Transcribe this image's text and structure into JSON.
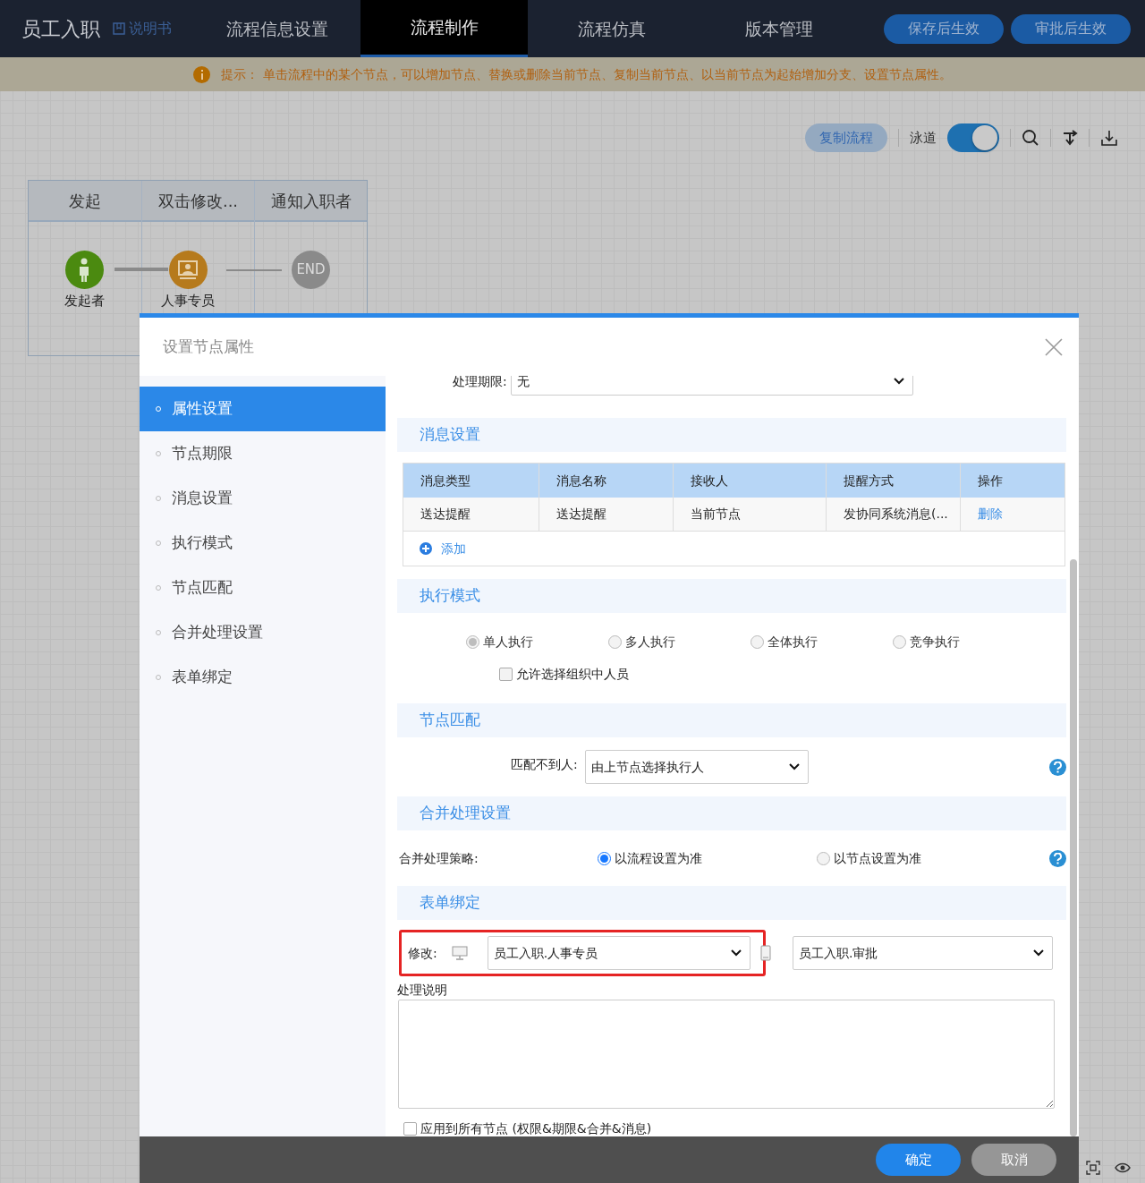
{
  "app": {
    "title": "员工入职",
    "manual_link": "说明书",
    "nav_tabs": [
      {
        "label": "流程信息设置",
        "selected": false
      },
      {
        "label": "流程制作",
        "selected": true
      },
      {
        "label": "流程仿真",
        "selected": false
      },
      {
        "label": "版本管理",
        "selected": false
      }
    ],
    "actions": [
      "保存后生效",
      "审批后生效"
    ]
  },
  "hint": {
    "text": "提示： 单击流程中的某个节点，可以增加节点、替换或删除当前节点、复制当前节点、以当前节点为起始增加分支、设置节点属性。"
  },
  "toolbar": {
    "copy_button": "复制流程",
    "lane_toggle": {
      "label": "泳道",
      "on": true
    }
  },
  "lanes": [
    {
      "title": "发起"
    },
    {
      "title": "双击修改..."
    },
    {
      "title": "通知入职者"
    }
  ],
  "nodes": [
    {
      "kind": "start",
      "label": "发起者"
    },
    {
      "kind": "task",
      "label": "人事专员"
    },
    {
      "kind": "end",
      "label": "END"
    }
  ],
  "dialog": {
    "title": "设置节点属性",
    "side_items": [
      {
        "label": "属性设置",
        "selected": true
      },
      {
        "label": "节点期限",
        "selected": false
      },
      {
        "label": "消息设置",
        "selected": false
      },
      {
        "label": "执行模式",
        "selected": false
      },
      {
        "label": "节点匹配",
        "selected": false
      },
      {
        "label": "合并处理设置",
        "selected": false
      },
      {
        "label": "表单绑定",
        "selected": false
      }
    ],
    "deadline": {
      "label": "处理期限:",
      "value": "无"
    },
    "message": {
      "title": "消息设置",
      "columns": [
        "消息类型",
        "消息名称",
        "接收人",
        "提醒方式",
        "操作"
      ],
      "rows": [
        [
          "送达提醒",
          "送达提醒",
          "当前节点",
          "发协同系统消息(...",
          "删除"
        ]
      ],
      "add_link": "添加"
    },
    "exec_mode": {
      "title": "执行模式",
      "disabled": true,
      "options": [
        {
          "label": "单人执行",
          "selected": true
        },
        {
          "label": "多人执行",
          "selected": false
        },
        {
          "label": "全体执行",
          "selected": false
        },
        {
          "label": "竞争执行",
          "selected": false
        }
      ],
      "org_checkbox": {
        "label": "允许选择组织中人员",
        "checked": false
      }
    },
    "match": {
      "title": "节点匹配",
      "label": "匹配不到人:",
      "value": "由上节点选择执行人"
    },
    "merge": {
      "title": "合并处理设置",
      "label": "合并处理策略:",
      "options": [
        {
          "label": "以流程设置为准",
          "selected": true
        },
        {
          "label": "以节点设置为准",
          "selected": false
        }
      ]
    },
    "form_binding": {
      "title": "表单绑定",
      "label": "修改:",
      "pc_form": "员工入职.人事专员",
      "mobile_form": "员工入职.审批",
      "highlighted": true
    },
    "note": {
      "label": "处理说明"
    },
    "apply_all": {
      "label": "应用到所有节点 (权限&期限&合并&消息)",
      "checked": false
    },
    "buttons": [
      {
        "kind": "primary",
        "label": "确定"
      },
      {
        "kind": "secondary",
        "label": "取消"
      }
    ]
  }
}
